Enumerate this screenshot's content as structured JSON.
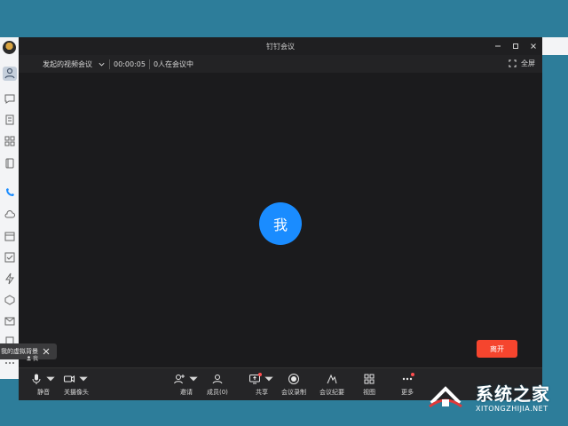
{
  "window": {
    "title": "钉钉会议"
  },
  "info_bar": {
    "meeting_name": "发起的视频会议",
    "timer": "00:00:05",
    "participants": "0人在会议中",
    "fullscreen_label": "全屏"
  },
  "video": {
    "self_label": "我"
  },
  "toolbar": {
    "mute": "静音",
    "camera": "关摄像头",
    "invite": "邀请",
    "members": "成员(0)",
    "share": "共享",
    "record": "会议录制",
    "minutes": "会议纪要",
    "view": "视图",
    "more": "更多",
    "leave": "离开"
  },
  "tooltip": {
    "text": "我的虚拟背景",
    "mini": "我"
  },
  "watermark": {
    "cn": "系统之家",
    "en": "XITONGZHIJIA.NET"
  },
  "colors": {
    "accent": "#1a8cff",
    "leave": "#f5452e",
    "window_bg": "#1c1c1e",
    "desktop": "#2d7d9a"
  }
}
